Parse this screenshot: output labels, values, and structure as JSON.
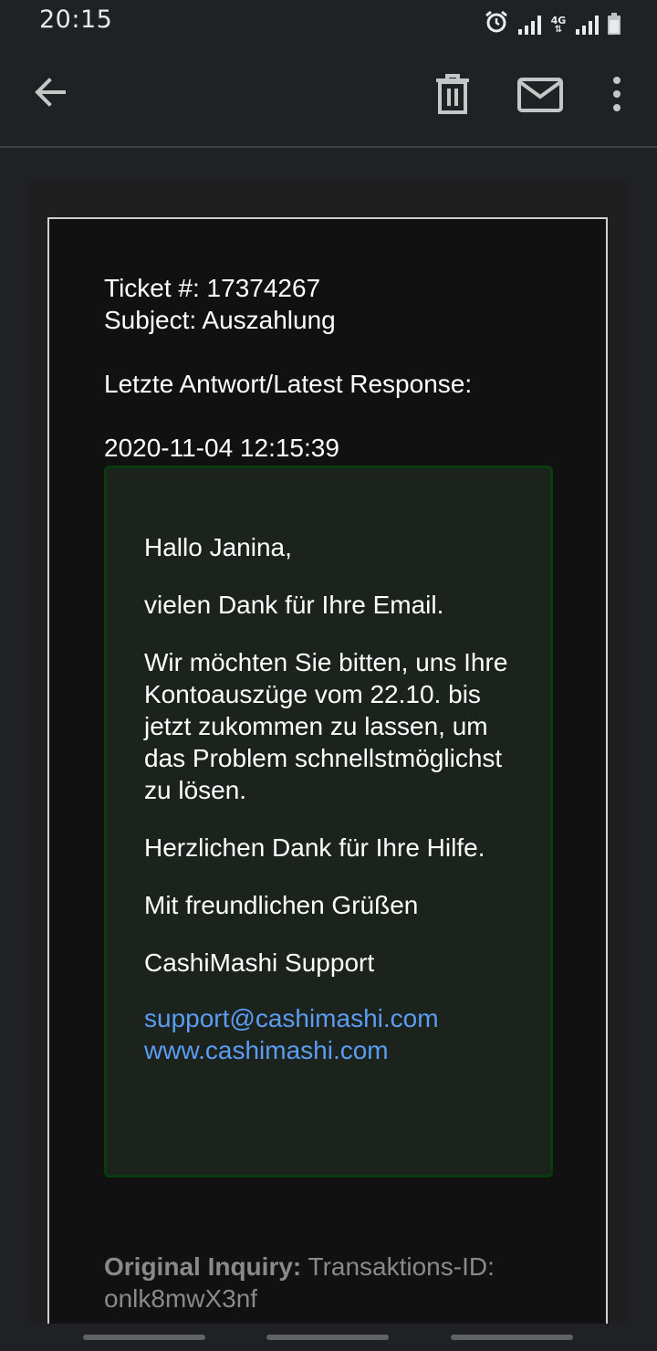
{
  "status_bar": {
    "time": "20:15",
    "network_label": "4G",
    "icons": [
      "alarm-icon",
      "signal-icon",
      "4g-icon",
      "signal-icon",
      "battery-icon"
    ]
  },
  "toolbar": {
    "icons": [
      "back-arrow-icon",
      "trash-icon",
      "mail-icon",
      "more-vert-icon"
    ]
  },
  "email": {
    "ticket_line": "Ticket #: 17374267",
    "subject_line": "Subject: Auszahlung",
    "latest_response_label": "Letzte Antwort/Latest Response:",
    "response_timestamp": "2020-11-04 12:15:39",
    "message": {
      "greeting": "Hallo Janina,",
      "thanks": "vielen Dank für Ihre Email.",
      "request": "Wir möchten Sie bitten, uns Ihre Kontoauszüge vom 22.10. bis jetzt zukommen zu lassen, um das Problem schnellstmöglichst zu lösen.",
      "help_thanks": "Herzlichen Dank für Ihre Hilfe.",
      "closing": "Mit freundlichen Grüßen",
      "signature": "CashiMashi Support",
      "support_email": "support@cashimashi.com",
      "website": "www.cashimashi.com"
    },
    "original_inquiry_label": "Original Inquiry:",
    "original_inquiry_text": " Transaktions-ID: onlk8mwX3nf"
  },
  "colors": {
    "background": "#202124",
    "card": "#111111",
    "response_box": "#1c221c",
    "response_border": "#0a3b10",
    "link": "#5b9cf5",
    "muted": "#8a8a8a"
  }
}
